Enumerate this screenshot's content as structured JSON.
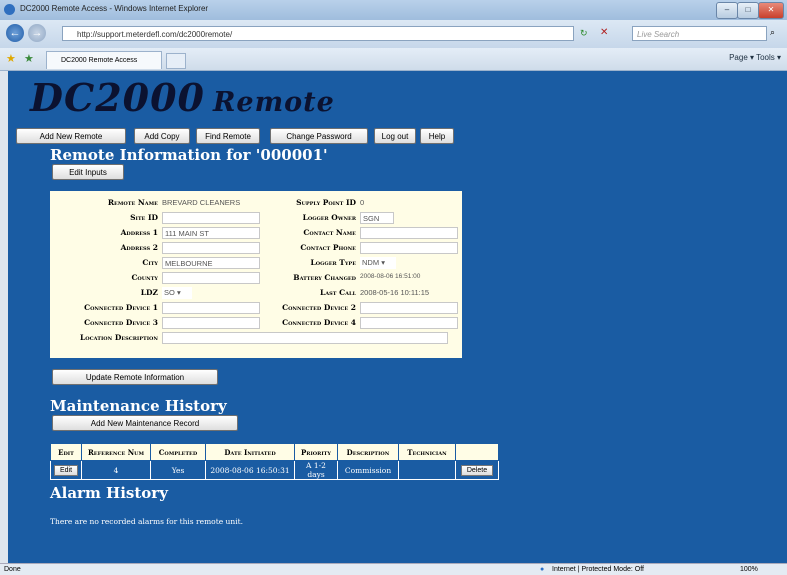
{
  "browser": {
    "window_title": "DC2000 Remote Access - Windows Internet Explorer",
    "url": "http://support.meterdefl.com/dc2000remote/",
    "search_placeholder": "Live Search",
    "tab_title": "DC2000 Remote Access",
    "tools": "Page ▾  Tools ▾",
    "status_left": "Done",
    "status_zone": "Internet | Protected Mode: Off",
    "zoom": "100%"
  },
  "app": {
    "logo_main": "DC2000",
    "logo_sub": "Remote",
    "nav": [
      "Add New Remote",
      "Add Copy",
      "Find Remote",
      "Change Password",
      "Log out",
      "Help"
    ],
    "info_heading": "Remote Information for '000001'",
    "edit_inputs": "Edit Inputs",
    "update_button": "Update Remote Information",
    "maintenance_heading": "Maintenance History",
    "add_maintenance": "Add New Maintenance Record",
    "alarm_heading": "Alarm History",
    "alarm_message": "There are no recorded alarms for this remote unit."
  },
  "form": {
    "remote_name_label": "Remote Name",
    "remote_name": "BREVARD CLEANERS",
    "site_id_label": "Site ID",
    "site_id": "",
    "address1_label": "Address 1",
    "address1": "111 MAIN ST",
    "address2_label": "Address 2",
    "address2": "",
    "city_label": "City",
    "city": "MELBOURNE",
    "county_label": "County",
    "county": "",
    "ldz_label": "LDZ",
    "ldz": "SO",
    "cd1_label": "Connected Device 1",
    "cd1": "",
    "cd3_label": "Connected Device 3",
    "cd3": "",
    "location_label": "Location Description",
    "location": "",
    "supply_point_label": "Supply Point ID",
    "supply_point": "0",
    "logger_owner_label": "Logger Owner",
    "logger_owner": "SGN",
    "contact_name_label": "Contact Name",
    "contact_name": "",
    "contact_phone_label": "Contact Phone",
    "contact_phone": "",
    "logger_type_label": "Logger Type",
    "logger_type": "NDM",
    "battery_label": "Battery Changed",
    "battery": "2008-08-06 16:51:00",
    "last_call_label": "Last Call",
    "last_call": "2008-05-16 10:11:15",
    "cd2_label": "Connected Device 2",
    "cd2": "",
    "cd4_label": "Connected Device 4",
    "cd4": ""
  },
  "maintenance": {
    "headers": [
      "Edit",
      "Reference Num",
      "Completed",
      "Date Initiated",
      "Priority",
      "Description",
      "Technician"
    ],
    "row": {
      "edit": "Edit",
      "reference": "4",
      "completed": "Yes",
      "date": "2008-08-06 16:50:31",
      "priority": "A 1-2 days",
      "description": "Commission",
      "technician": "",
      "delete": "Delete"
    }
  }
}
